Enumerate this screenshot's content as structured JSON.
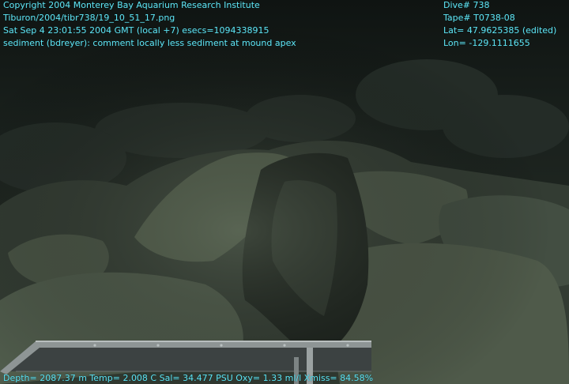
{
  "overlay": {
    "left": [
      "Copyright 2004 Monterey Bay Aquarium Research Institute",
      "Tiburon/2004/tibr738/19_10_51_17.png",
      "Sat Sep  4 23:01:55 2004 GMT (local +7)  esecs=1094338915",
      "sediment (bdreyer): comment locally less sediment at mound apex"
    ],
    "right": [
      "Dive# 738",
      "Tape# T0738-08",
      "Lat= 47.9625385 (edited)",
      "Lon= -129.1111655"
    ],
    "bottom": "Depth= 2087.37 m  Temp= 2.008 C  Sal= 34.477 PSU  Oxy= 1.33 ml/l  Xmiss= 84.58%"
  },
  "colors": {
    "overlay_text": "#5fe3f2",
    "water": "#141a17",
    "rock": "#4e5a4c",
    "rock_shadow": "#1f261f",
    "sampler_frame": "#9aa0a0"
  }
}
